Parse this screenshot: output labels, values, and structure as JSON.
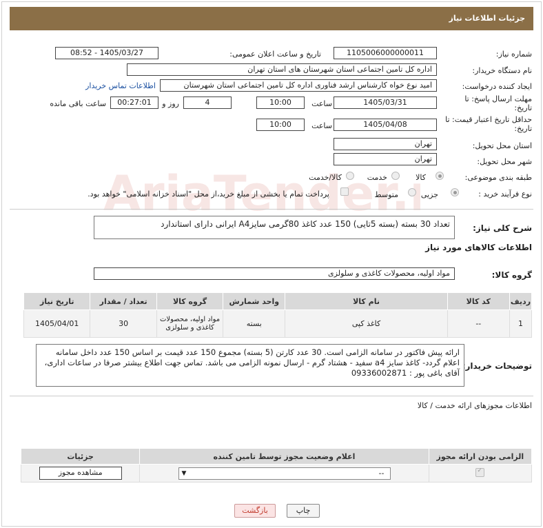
{
  "header": {
    "title": "جزئیات اطلاعات نیاز"
  },
  "form": {
    "need_number_label": "شماره نیاز:",
    "need_number": "1105006000000011",
    "announce_label": "تاریخ و ساعت اعلان عمومی:",
    "announce_value": "1405/03/27 - 08:52",
    "buyer_label": "نام دستگاه خریدار:",
    "buyer_value": "اداره کل تامین اجتماعی استان شهرستان های استان تهران",
    "creator_label": "ایجاد کننده درخواست:",
    "creator_value": "امید نوع خواه کارشناس ارشد فناوری اداره کل تامین اجتماعی استان شهرستان",
    "contact_link": "اطلاعات تماس خریدار",
    "deadline_label": "مهلت ارسال پاسخ: تا تاریخ:",
    "deadline_date": "1405/03/31",
    "time_label": "ساعت",
    "deadline_time": "10:00",
    "days_value": "4",
    "days_label": "روز و",
    "remaining_value": "00:27:01",
    "remaining_label": "ساعت باقی مانده",
    "validity_label": "حداقل تاریخ اعتبار قیمت: تا تاریخ:",
    "validity_date": "1405/04/08",
    "validity_time_label": "ساعت",
    "validity_time": "10:00",
    "province_label": "استان محل تحویل:",
    "province_value": "تهران",
    "city_label": "شهر محل تحویل:",
    "city_value": "تهران",
    "category_label": "طبقه بندی موضوعی:",
    "category_options": [
      "کالا",
      "خدمت",
      "کالا/خدمت"
    ],
    "process_label": "نوع فرآیند خرید :",
    "process_options": [
      "جزیی",
      "متوسط"
    ],
    "payment_text": "پرداخت تمام یا بخشی از مبلغ خرید،از محل \"اسناد خزانه اسلامی\" خواهد بود."
  },
  "description": {
    "label": "شرح کلی نیاز:",
    "value": "تعداد 30 بسته (بسته 5تایی) 150 عدد کاغذ 80گرمی سایزA4 ایرانی دارای استاندارد"
  },
  "goods": {
    "section_title": "اطلاعات کالاهای مورد نیاز",
    "group_label": "گروه کالا:",
    "group_value": "مواد اولیه، محصولات کاغذی و سلولزی",
    "columns": [
      "ردیف",
      "کد کالا",
      "نام کالا",
      "واحد شمارش",
      "گروه کالا",
      "تعداد / مقدار",
      "تاریخ نیاز"
    ],
    "rows": [
      {
        "row": "1",
        "code": "--",
        "name": "کاغذ کپی",
        "unit": "بسته",
        "group": "مواد اولیه، محصولات کاغذی و سلولزی",
        "qty": "30",
        "date": "1405/04/01"
      }
    ]
  },
  "buyer_notes": {
    "label": "توضیحات خریدار:",
    "value": "ارائه پیش فاکتور در سامانه الزامی است. 30 عدد کارتن (5 بسته) مجموع 150 عدد قیمت بر اساس 150 عدد داخل سامانه اعلام گردد- کاغذ سایز a4 سفید - هشتاد گرم - ارسال نمونه الزامی می باشد. تماس جهت اطلاع بیشتر صرفا در ساعات اداری، آقای باغی پور : 09336002871"
  },
  "permits": {
    "title": "اطلاعات مجوزهای ارائه خدمت / کالا",
    "columns": [
      "الزامی بودن ارائه مجوز",
      "اعلام وضعیت مجوز توسط تامین کننده",
      "جزئیات"
    ],
    "select_value": "--",
    "view_button": "مشاهده مجوز"
  },
  "actions": {
    "print": "چاپ",
    "back": "بازگشت"
  },
  "watermark": {
    "text": "AriaTender.net"
  }
}
